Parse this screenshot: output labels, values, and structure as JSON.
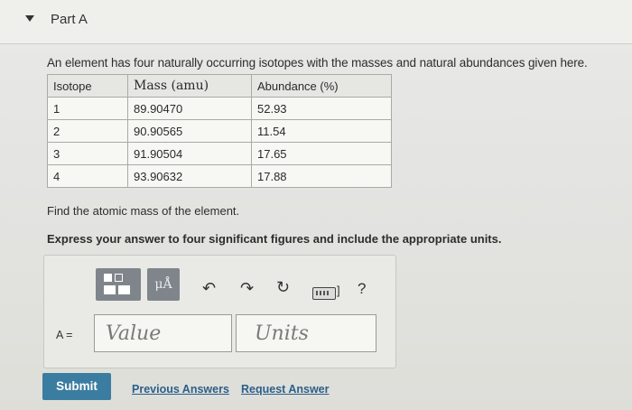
{
  "part": {
    "title": "Part A"
  },
  "question": {
    "intro": "An element has four naturally occurring isotopes with the masses and natural abundances given here.",
    "table": {
      "headers": [
        "Isotope",
        "Mass (amu)",
        "Abundance (%)"
      ],
      "rows": [
        [
          "1",
          "89.90470",
          "52.93"
        ],
        [
          "2",
          "90.90565",
          "11.54"
        ],
        [
          "3",
          "91.90504",
          "17.65"
        ],
        [
          "4",
          "93.90632",
          "17.88"
        ]
      ]
    },
    "prompt": "Find the atomic mass of the element.",
    "instruction": "Express your answer to four significant figures and include the appropriate units."
  },
  "answer": {
    "toolbar": {
      "symbol_label": "μÅ",
      "help_label": "?",
      "keyboard_bracket": "]"
    },
    "variable_label": "A =",
    "value_placeholder": "Value",
    "units_placeholder": "Units"
  },
  "actions": {
    "submit_label": "Submit",
    "previous_answers_label": "Previous Answers",
    "request_answer_label": "Request Answer"
  },
  "colors": {
    "submit_bg": "#3b7da1",
    "link": "#2b5f89",
    "toolbar_bg": "#7f858a"
  }
}
